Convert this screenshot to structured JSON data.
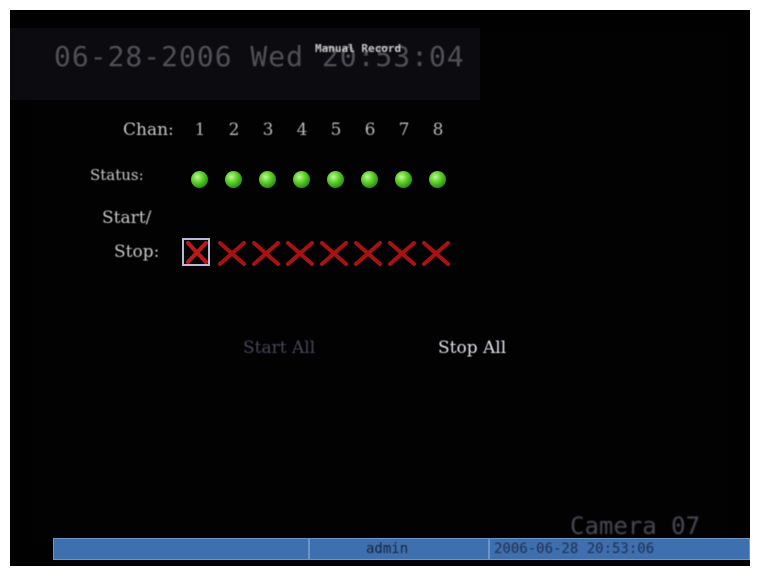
{
  "osd": {
    "timestamp": "06-28-2006 Wed 20:53:04",
    "window_title": "Manual Record"
  },
  "record_panel": {
    "chan_label": "Chan:",
    "status_label": "Status:",
    "start_label": "Start/",
    "stop_label": "Stop:",
    "channels": [
      "1",
      "2",
      "3",
      "4",
      "5",
      "6",
      "7",
      "8"
    ],
    "status_color": "#5fd52b",
    "xmark_color": "#c01818",
    "selected_channel": "1"
  },
  "buttons": {
    "start_all": "Start All",
    "stop_all": "Stop All"
  },
  "camera_overlay": "Camera 07",
  "status_bar": {
    "user": "admin",
    "datetime": "2006-06-28 20:53:06",
    "bar_color": "#3e6fae"
  }
}
